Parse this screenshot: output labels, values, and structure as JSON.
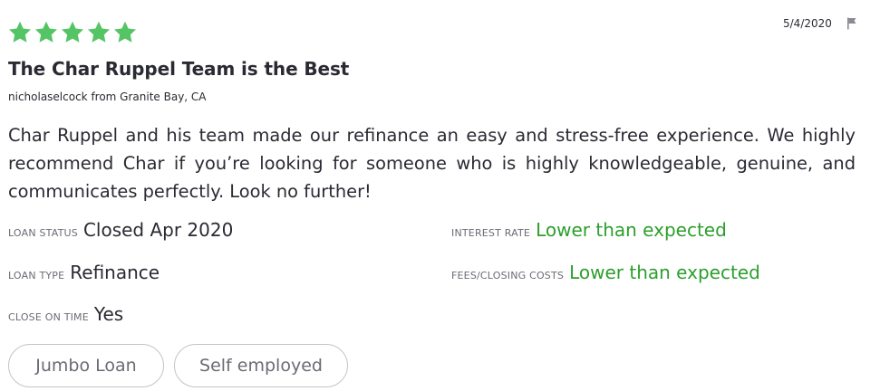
{
  "review": {
    "rating_stars": 5,
    "star_color": "#54c464",
    "date": "5/4/2020",
    "flag_icon": "flag-icon",
    "title": "The Char Ruppel Team is the Best",
    "author_line": "nicholaselcock from Granite Bay, CA",
    "body": "Char Ruppel and his team made our refinance an easy and stress-free experience. We highly recommend Char if you’re looking for someone who is highly knowledgeable, genuine, and communicates perfectly. Look no further!",
    "details": {
      "loan_status": {
        "label": "LOAN STATUS",
        "value": "Closed Apr 2020"
      },
      "interest_rate": {
        "label": "INTEREST RATE",
        "value": "Lower than expected",
        "color": "#2c9f2c"
      },
      "loan_type": {
        "label": "LOAN TYPE",
        "value": "Refinance"
      },
      "fees_closing_costs": {
        "label": "FEES/CLOSING COSTS",
        "value": "Lower than expected",
        "color": "#2c9f2c"
      },
      "close_on_time": {
        "label": "CLOSE ON TIME",
        "value": "Yes"
      }
    },
    "tags": [
      "Jumbo Loan",
      "Self employed"
    ]
  }
}
